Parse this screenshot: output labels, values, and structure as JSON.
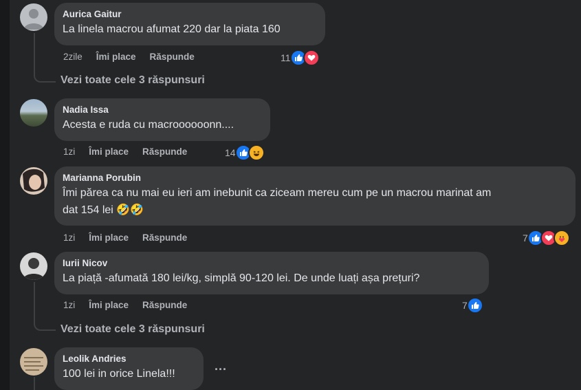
{
  "comments": [
    {
      "author": "Aurica Gaitur",
      "text": "La linela macrou afumat 220 dar la piata 160",
      "time": "2zile",
      "like": "Îmi place",
      "reply": "Răspunde",
      "reactions_count": "11",
      "reactions": [
        "like-icon",
        "love-icon"
      ]
    },
    {
      "author": "Nadia Issa",
      "text": "Acesta e ruda cu macroooooonn....",
      "time": "1zi",
      "like": "Îmi place",
      "reply": "Răspunde",
      "reactions_count": "14",
      "reactions": [
        "like-icon",
        "haha-icon"
      ]
    },
    {
      "author": "Marianna Porubin",
      "text_line1": "Îmi părea ca nu mai eu ieri am inebunit ca ziceam mereu cum pe un macrou marinat am",
      "text_line2": "dat 154 lei",
      "emoji": "🤣🤣",
      "time": "1zi",
      "like": "Îmi place",
      "reply": "Răspunde",
      "reactions_count": "7",
      "reactions": [
        "like-icon",
        "love-icon",
        "care-icon"
      ]
    },
    {
      "author": "Iurii Nicov",
      "text": "La piață -afumată 180 lei/kg, simplă 90-120 lei. De unde luați așa prețuri?",
      "time": "1zi",
      "like": "Îmi place",
      "reply": "Răspunde",
      "reactions_count": "7",
      "reactions": [
        "like-icon"
      ]
    },
    {
      "author": "Leolik Andries",
      "text": "100 lei in orice Linela!!!",
      "more": "..."
    }
  ],
  "see_all_replies_1": "Vezi toate cele 3 răspunsuri",
  "see_all_replies_2": "Vezi toate cele 3 răspunsuri",
  "colors": {
    "background": "#242526",
    "bubble": "#3a3b3c",
    "text": "#e4e6eb",
    "muted": "#b0b3b8",
    "like": "#1877f2",
    "love": "#f33e58"
  }
}
